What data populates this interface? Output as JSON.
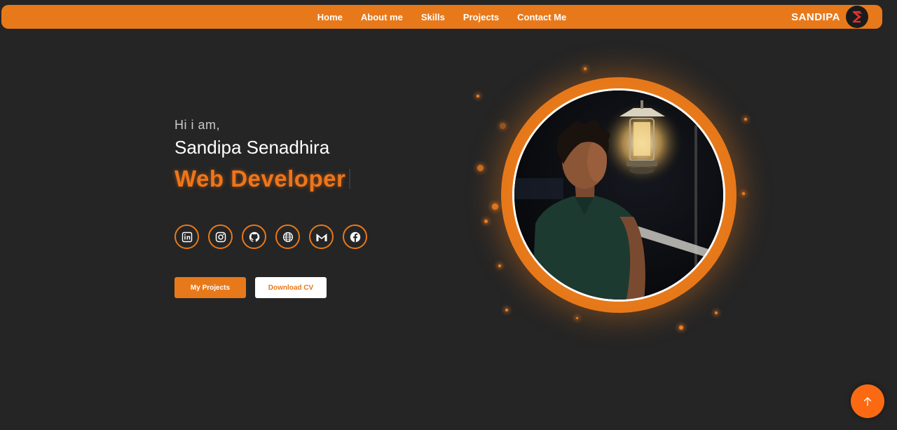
{
  "nav": {
    "links": [
      "Home",
      "About me",
      "Skills",
      "Projects",
      "Contact Me"
    ],
    "brand": "SANDIPA"
  },
  "hero": {
    "greeting": "Hi i am,",
    "name": "Sandipa Senadhira",
    "role": "Web Developer"
  },
  "socials": [
    {
      "icon": "linkedin-icon"
    },
    {
      "icon": "instagram-icon"
    },
    {
      "icon": "github-icon"
    },
    {
      "icon": "globe-icon"
    },
    {
      "icon": "gmail-icon"
    },
    {
      "icon": "facebook-icon"
    }
  ],
  "buttons": {
    "projects": "My Projects",
    "cv": "Download CV"
  },
  "colors": {
    "accent": "#e8791a",
    "background": "#252525",
    "scroll_top": "#fb6a12"
  },
  "scroll_top_icon": "arrow-up-icon"
}
